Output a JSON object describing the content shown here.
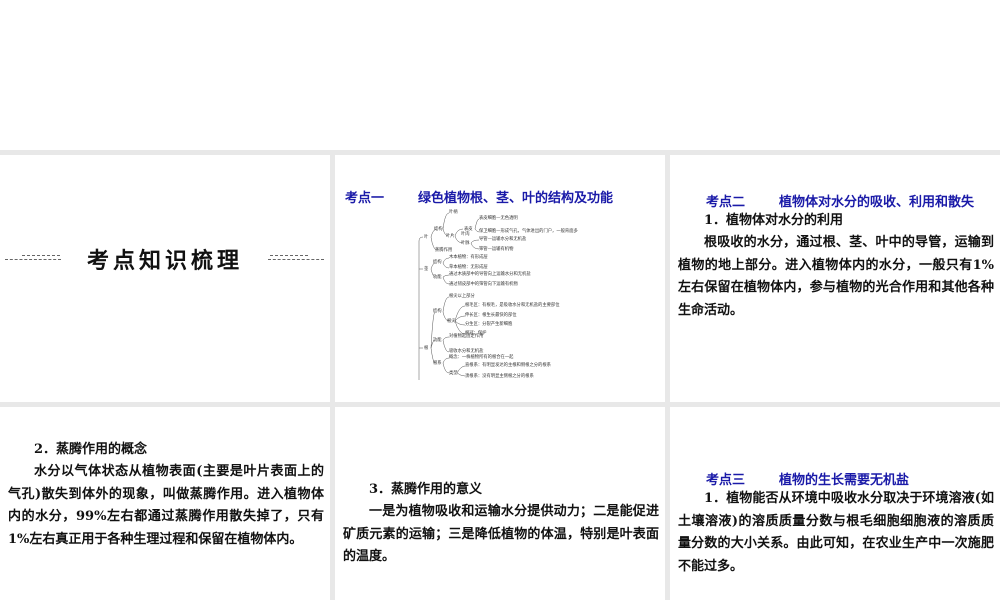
{
  "title": "考点知识梳理",
  "k1": {
    "label": "考点一",
    "title": "绿色植物根、茎、叶的结构及功能"
  },
  "diagram": [
    "叶",
    "结构",
    "叶柄",
    "叶片",
    "表皮",
    "表皮细胞—无色透明",
    "保卫细胞—形成气孔，气体进出的门户，一般背面多",
    "叶肉",
    "叶脉",
    "导管—运输水分和无机盐",
    "筛管—运输有机物",
    "蒸腾作用",
    "茎",
    "结构",
    "木本植物：有形成层",
    "草本植物：无形成层",
    "功能",
    "通过木质部中的导管向上运输水分和无机盐",
    "通过韧皮部中的筛管向下运输有机物",
    "根",
    "结构",
    "根尖以上部分",
    "根尖",
    "根毛区：有根毛，是吸收水分和无机盐的主要部位",
    "伸长区：根生长最快的部位",
    "分生区：分裂产生新细胞",
    "根冠：保护",
    "功能",
    "对植物起固定作用",
    "吸收水分和无机盐",
    "根系",
    "概念：一株植物所有的根合在一起",
    "类型",
    "直根系：有明显发达的主根和侧根之分的根系",
    "须根系：没有明显主侧根之分的根系"
  ],
  "k2": {
    "label": "考点二",
    "title": "植物体对水分的吸收、利用和散失",
    "sub": "1．植物体对水分的利用",
    "body": "根吸收的水分，通过根、茎、叶中的导管，运输到植物的地上部分。进入植物体内的水分，一般只有1%左右保留在植物体内，参与植物的光合作用和其他各种生命活动。"
  },
  "c4": {
    "sub": "2．蒸腾作用的概念",
    "body": "水分以气体状态从植物表面(主要是叶片表面上的气孔)散失到体外的现象，叫做蒸腾作用。进入植物体内的水分，99%左右都通过蒸腾作用散失掉了，只有1%左右真正用于各种生理过程和保留在植物体内。"
  },
  "c5": {
    "sub": "3．蒸腾作用的意义",
    "body": "一是为植物吸收和运输水分提供动力；二是能促进矿质元素的运输；三是降低植物的体温，特别是叶表面的温度。"
  },
  "k3": {
    "label": "考点三",
    "title": "植物的生长需要无机盐",
    "body": "1．植物能否从环境中吸收水分取决于环境溶液(如土壤溶液)的溶质质量分数与根毛细胞细胞液的溶质质量分数的大小关系。由此可知，在农业生产中一次施肥不能过多。"
  }
}
